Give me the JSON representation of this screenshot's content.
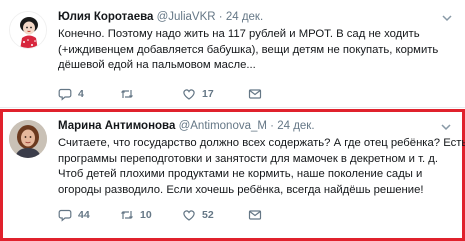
{
  "tweets": [
    {
      "name": "Юлия Коротаева",
      "handle": "@JuliaVKR",
      "separator": "·",
      "date": "24 дек.",
      "text_lines": [
        "Конечно. Поэтому надо жить на 117 рублей и МРОТ. В сад не ходить",
        "(+иждивенцем добавляется бабушка), вещи детям не покупать, кормить",
        "дёшевой едой на пальмовом масле..."
      ],
      "reply_count": "4",
      "retweet_count": "",
      "like_count": "17"
    },
    {
      "name": "Марина Антимонова",
      "handle": "@Antimonova_M",
      "separator": "·",
      "date": "24 дек.",
      "text_lines": [
        "Считаете, что государство должно всех содержать?  А где отец ребёнка? Есть",
        "программы переподготовки и занятости для мамочек в декретном и т. д.",
        "Чтоб детей плохими продуктами не кормить, наше поколение сады и",
        "огороды разводило. Если хочешь ребёнка, всегда найдёшь решение!"
      ],
      "reply_count": "44",
      "retweet_count": "10",
      "like_count": "52"
    }
  ],
  "icons": {
    "reply": "reply-icon",
    "retweet": "retweet-icon",
    "like": "heart-icon",
    "dm": "envelope-icon",
    "more": "chevron-down-icon"
  },
  "colors": {
    "highlight_border": "#e0212c",
    "secondary_text": "#657786"
  }
}
